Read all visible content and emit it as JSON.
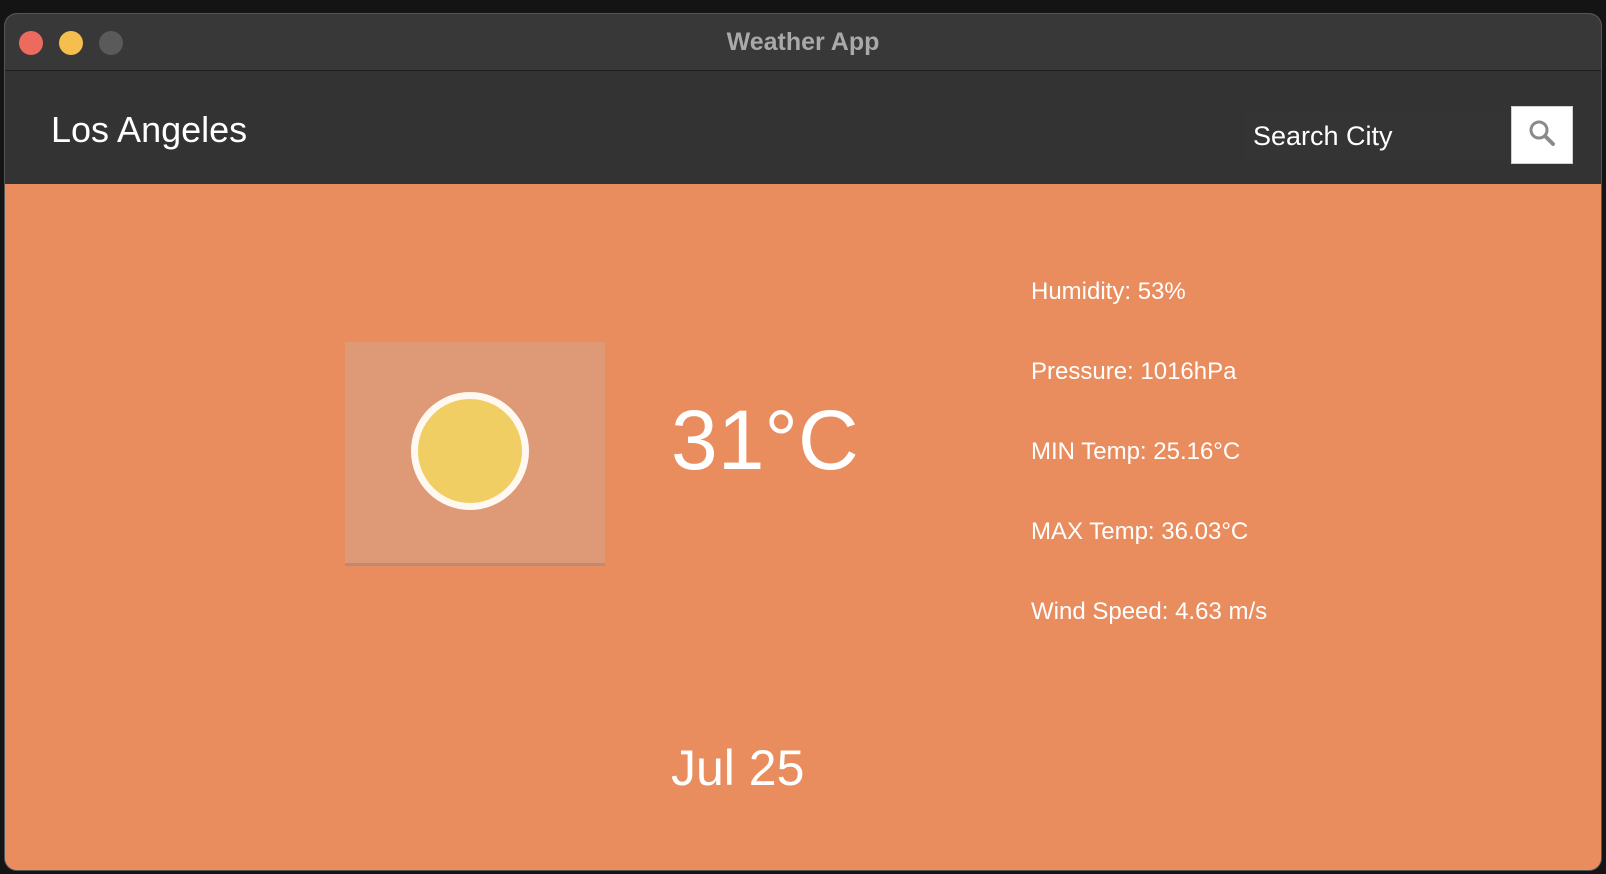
{
  "window": {
    "title": "Weather App"
  },
  "header": {
    "city": "Los Angeles",
    "search": {
      "placeholder": "Search City",
      "button_icon": "search-icon"
    }
  },
  "weather": {
    "icon": "sun-icon",
    "temperature": "31°C",
    "date": "Jul 25",
    "details": {
      "humidity": "Humidity: 53%",
      "pressure": "Pressure: 1016hPa",
      "min_temp": "MIN Temp: 25.16°C",
      "max_temp": "MAX Temp: 36.03°C",
      "wind_speed": "Wind Speed: 4.63 m/s"
    }
  },
  "colors": {
    "background": "#e98d5f",
    "header": "#333333",
    "titlebar": "#383838",
    "sun": "#f0ce63"
  }
}
